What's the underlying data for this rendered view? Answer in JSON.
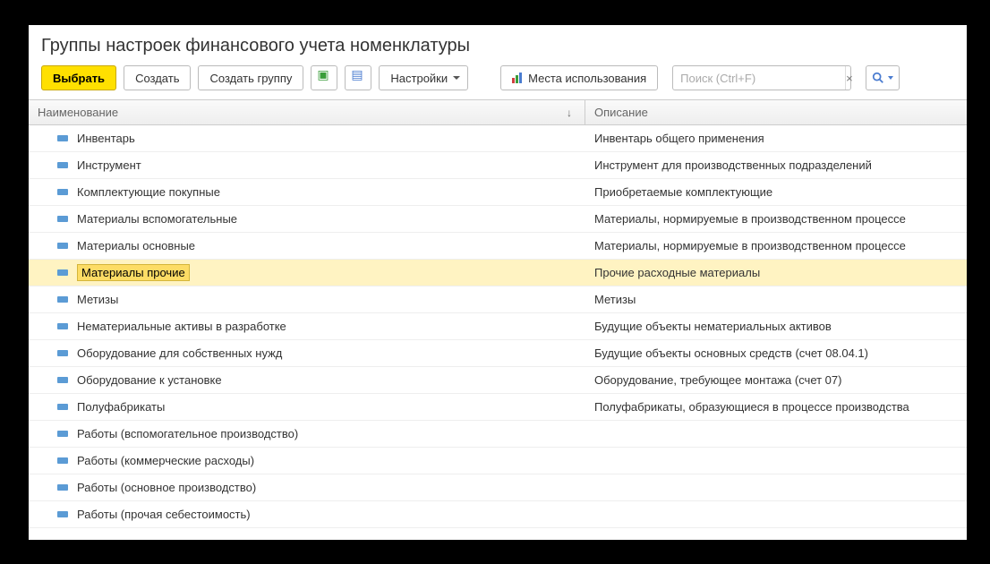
{
  "title": "Группы настроек финансового учета номенклатуры",
  "toolbar": {
    "select_label": "Выбрать",
    "create_label": "Создать",
    "create_group_label": "Создать группу",
    "settings_label": "Настройки",
    "usage_places_label": "Места использования"
  },
  "search": {
    "placeholder": "Поиск (Ctrl+F)"
  },
  "columns": {
    "name": "Наименование",
    "description": "Описание"
  },
  "rows": [
    {
      "name": "Инвентарь",
      "desc": "Инвентарь общего применения",
      "selected": false
    },
    {
      "name": "Инструмент",
      "desc": "Инструмент для производственных подразделений",
      "selected": false
    },
    {
      "name": "Комплектующие покупные",
      "desc": "Приобретаемые комплектующие",
      "selected": false
    },
    {
      "name": "Материалы вспомогательные",
      "desc": "Материалы, нормируемые в производственном процессе",
      "selected": false
    },
    {
      "name": "Материалы основные",
      "desc": "Материалы, нормируемые в производственном процессе",
      "selected": false
    },
    {
      "name": "Материалы прочие",
      "desc": "Прочие расходные материалы",
      "selected": true
    },
    {
      "name": "Метизы",
      "desc": "Метизы",
      "selected": false
    },
    {
      "name": "Нематериальные активы в разработке",
      "desc": "Будущие объекты нематериальных активов",
      "selected": false
    },
    {
      "name": "Оборудование для собственных нужд",
      "desc": "Будущие объекты основных средств (счет 08.04.1)",
      "selected": false
    },
    {
      "name": "Оборудование к установке",
      "desc": "Оборудование, требующее монтажа (счет 07)",
      "selected": false
    },
    {
      "name": "Полуфабрикаты",
      "desc": "Полуфабрикаты, образующиеся в процессе производства",
      "selected": false
    },
    {
      "name": "Работы (вспомогательное производство)",
      "desc": "",
      "selected": false
    },
    {
      "name": "Работы (коммерческие расходы)",
      "desc": "",
      "selected": false
    },
    {
      "name": "Работы (основное производство)",
      "desc": "",
      "selected": false
    },
    {
      "name": "Работы (прочая себестоимость)",
      "desc": "",
      "selected": false
    }
  ]
}
